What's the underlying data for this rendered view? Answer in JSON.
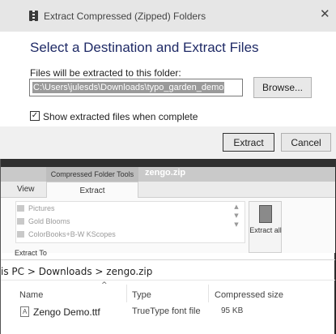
{
  "dialog": {
    "title": "Extract Compressed (Zipped) Folders",
    "close_glyph": "✕",
    "heading": "Select a Destination and Extract Files",
    "destination_label": "Files will be extracted to this folder:",
    "destination_path": "C:\\Users\\julesds\\Downloads\\typo_garden_demo",
    "browse_label": "Browse...",
    "show_files_checked": true,
    "check_glyph": "✓",
    "show_files_label": "Show extracted files when complete",
    "extract_label": "Extract",
    "cancel_label": "Cancel"
  },
  "explorer": {
    "context_tab_label": "Compressed Folder Tools",
    "window_title": "zengo.zip",
    "tabs": [
      {
        "label": "View"
      },
      {
        "label": "Extract"
      }
    ],
    "destinations": [
      {
        "label": "Pictures"
      },
      {
        "label": "Gold Blooms"
      },
      {
        "label": "ColorBooks+B-W KScopes"
      }
    ],
    "scroll_up_glyph": "▲",
    "scroll_mid_glyph": "▼",
    "scroll_down_glyph": "▼",
    "extract_all_label": "Extract all",
    "group_label": "Extract To",
    "address": "is PC  >  Downloads  >  zengo.zip",
    "sort_glyph": "^",
    "columns": {
      "name": "Name",
      "type": "Type",
      "size": "Compressed size"
    },
    "files": [
      {
        "name": "Zengo Demo.ttf",
        "type": "TrueType font file",
        "size": "95 KB",
        "icon": "font-file-icon"
      }
    ]
  }
}
